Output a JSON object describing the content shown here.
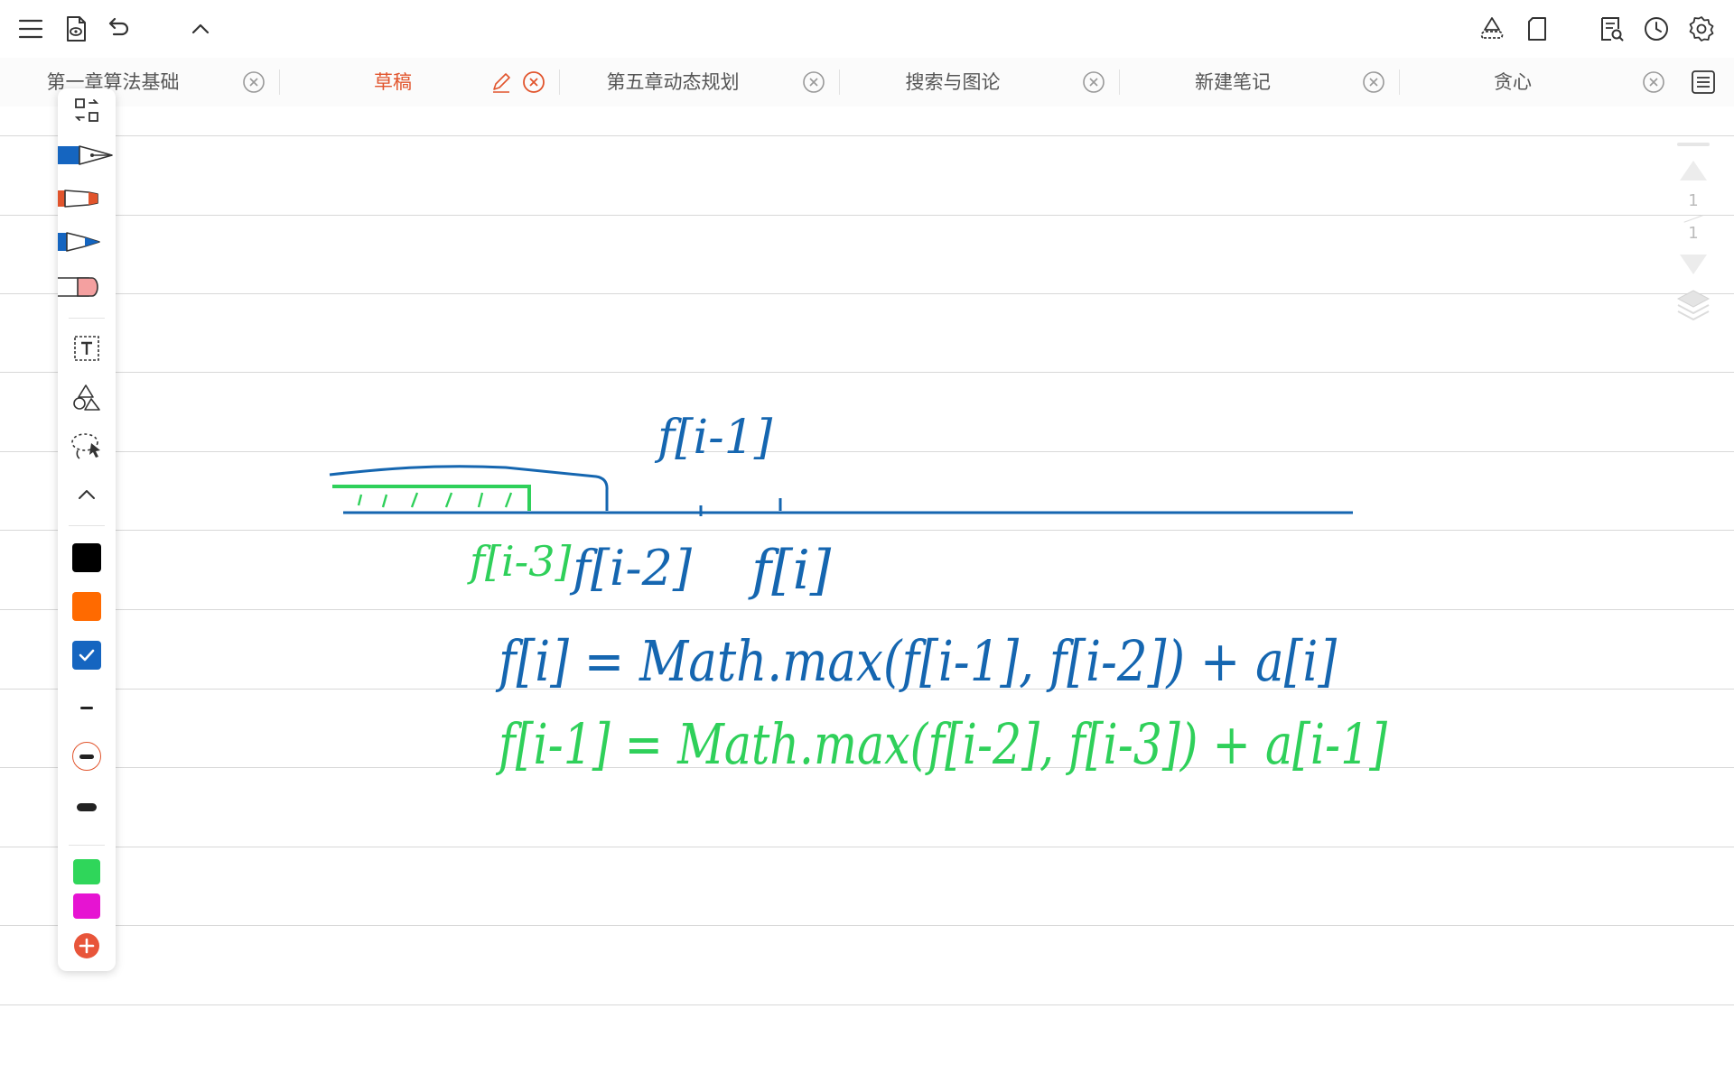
{
  "toolbar": {
    "left_icons": [
      "menu-icon",
      "document-preview-icon",
      "undo-icon",
      "chevron-up-icon"
    ],
    "right_icons": [
      "shapes-cloud-icon",
      "page-icon",
      "search-document-icon",
      "history-clock-icon",
      "gear-icon"
    ]
  },
  "tabs": [
    {
      "label": "第一章算法基础",
      "active": false
    },
    {
      "label": "草稿",
      "active": true
    },
    {
      "label": "第五章动态规划",
      "active": false
    },
    {
      "label": "搜索与图论",
      "active": false
    },
    {
      "label": "新建笔记",
      "active": false
    },
    {
      "label": "贪心",
      "active": false
    }
  ],
  "palette": {
    "tools": [
      "swap-layout-icon",
      "fountain-pen-icon",
      "marker-icon",
      "pen-icon",
      "eraser-icon",
      "text-box-icon",
      "shapes-icon",
      "lasso-select-icon",
      "collapse-chevron-icon"
    ],
    "colors": [
      "#000000",
      "#ff6a00",
      "#1565c0"
    ],
    "selected_color": "#1565c0",
    "stroke_sizes": [
      "thin",
      "medium",
      "thick"
    ],
    "selected_stroke": "medium",
    "extra_colors": [
      "#2fd65a",
      "#e614d2"
    ],
    "add_color_icon": "add-color-icon"
  },
  "page_nav": {
    "current_page": "1",
    "total_pages": "1"
  },
  "accent_color": "#e1542c",
  "ink_colors": {
    "blue": "#1566b0",
    "green": "#2fd05a"
  },
  "handwriting": {
    "top_label": "f[i-1]",
    "under_labels": [
      "f[i-3]",
      "f[i-2]",
      "f[i]"
    ],
    "formula_blue": "f[i] = Math.max(f[i-1], f[i-2]) + a[i]",
    "formula_green": "f[i-1] = Math.max(f[i-2], f[i-3]) + a[i-1]"
  }
}
